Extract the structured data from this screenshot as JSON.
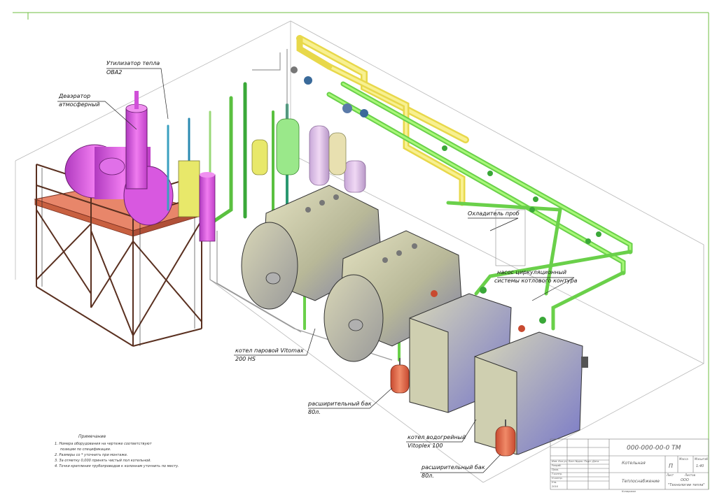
{
  "labels": {
    "heat_recovery": "Утилизатор тепла",
    "heat_recovery_model": "OBA2",
    "deaerator_1": "Деаэратор",
    "deaerator_2": "атмосферный",
    "sample_cooler": "Охладитель проб",
    "pump_1": "насос циркуляционный",
    "pump_2": "системы котлового контура",
    "steam_boiler_1": "котел паровой Vitomax",
    "steam_boiler_2": "200 HS",
    "exp_tank_a_1": "расширительный бак",
    "exp_tank_a_2": "80л.",
    "water_boiler_1": "котел водогрейный",
    "water_boiler_2": "Vitoplex 100",
    "exp_tank_b_1": "расширительный бак",
    "exp_tank_b_2": "80л."
  },
  "notes": {
    "title": "Примечание",
    "lines": [
      "1. Номера оборудования на чертеже соответствуют",
      "позиции по спецификации.",
      "2. Размеры со * уточнить при монтаже.",
      "3. За отметку 0,000 принять чистый пол котельной.",
      "4. Точки крепления трубопроводов к колоннам уточнить по месту."
    ]
  },
  "title_block": {
    "code": "000-000-00-0  ТМ",
    "object": "Котельная",
    "drawing": "Теплоснабжение",
    "stage": "П",
    "sheet_hdr": "Лист",
    "sheets_hdr": "Листов",
    "stage_hdr": "Стадия",
    "mass_hdr": "Масса",
    "scale_hdr": "Масштаб",
    "scale": "1:40",
    "company": "ООО",
    "company_name": "\"Технологии тепла\"",
    "row1": "Изм. Кол.уч. Лист №док. Подп. Дата",
    "row2": "Разраб.",
    "row3": "Пров.",
    "row4": "Т.контр.",
    "row5": "Н.контр.",
    "row6": "Утв.",
    "year": "2016",
    "footer": "Копировал"
  },
  "colors": {
    "frame": "#6fbf40",
    "steam": "#f0e86a",
    "water": "#8fee60",
    "deaerator": "#d64be0",
    "platform": "#e8866a",
    "boiler": "#c8c6a2",
    "tank_red": "#e86a4a",
    "wire": "#b9b9b9"
  }
}
